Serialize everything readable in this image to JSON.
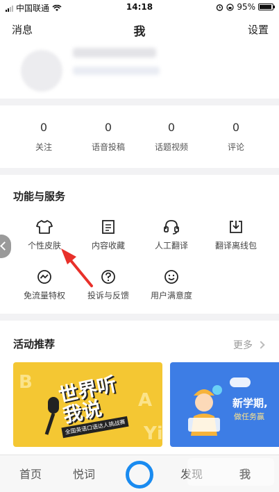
{
  "status_bar": {
    "carrier": "中国联通",
    "time": "14:18",
    "battery": "95%",
    "battery_level": 0.95,
    "icons": [
      "signal-icon",
      "wifi-icon",
      "alarm-icon",
      "lock-rotation-icon",
      "battery-icon"
    ]
  },
  "nav": {
    "left": "消息",
    "title": "我",
    "right": "设置"
  },
  "stats": [
    {
      "value": "0",
      "label": "关注"
    },
    {
      "value": "0",
      "label": "语音投稿"
    },
    {
      "value": "0",
      "label": "话题视频"
    },
    {
      "value": "0",
      "label": "评论"
    }
  ],
  "services": {
    "title": "功能与服务",
    "items": [
      {
        "label": "个性皮肤",
        "icon": "tshirt-icon"
      },
      {
        "label": "内容收藏",
        "icon": "document-icon"
      },
      {
        "label": "人工翻译",
        "icon": "headset-icon"
      },
      {
        "label": "翻译离线包",
        "icon": "download-icon"
      },
      {
        "label": "免流量特权",
        "icon": "traffic-icon"
      },
      {
        "label": "投诉与反馈",
        "icon": "question-icon"
      },
      {
        "label": "用户满意度",
        "icon": "smile-icon"
      }
    ]
  },
  "activity": {
    "title": "活动推荐",
    "more": "更多",
    "banner1": {
      "title": "世界听我说",
      "subtitle": "全国英语口语达人挑战赛"
    },
    "banner2": {
      "title": "新学期,",
      "subtitle": "做任务赢"
    }
  },
  "tabs": [
    {
      "label": "首页"
    },
    {
      "label": "悦词"
    },
    {
      "label": "发现"
    },
    {
      "label": "我"
    }
  ],
  "colors": {
    "accent": "#1a8bf0",
    "arrow": "#e8302a",
    "banner1": "#f4c733",
    "banner2": "#3d7de5"
  }
}
